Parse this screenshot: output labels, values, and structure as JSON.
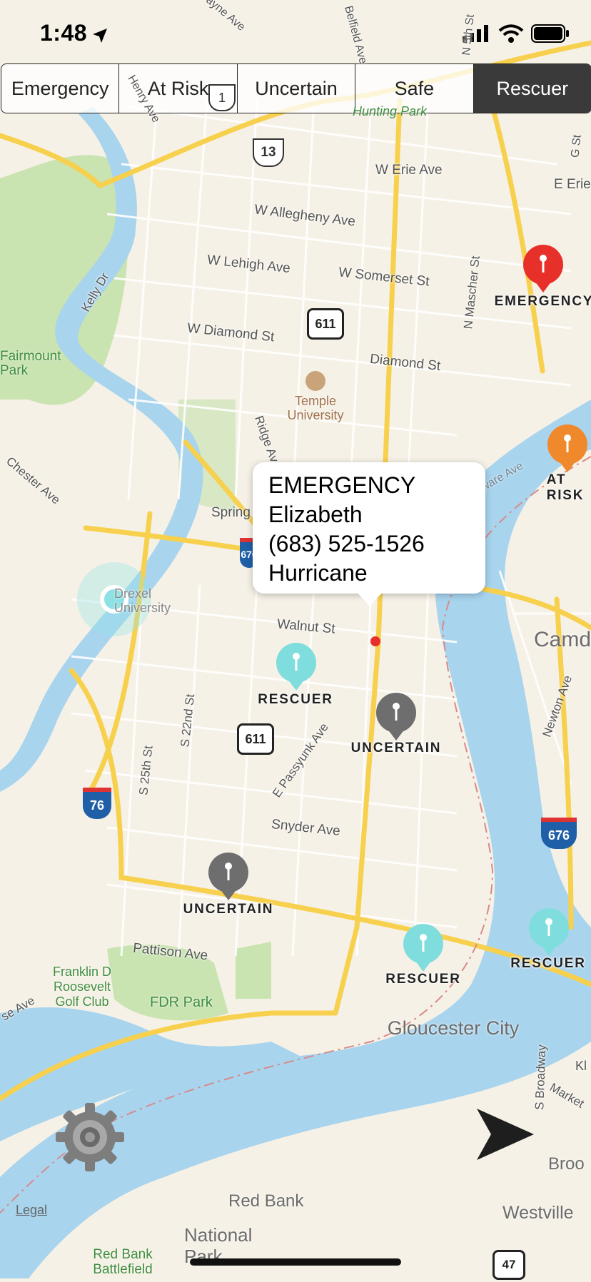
{
  "status_bar": {
    "time": "1:48"
  },
  "filters": {
    "segments": [
      "Emergency",
      "At Risk",
      "Uncertain",
      "Safe",
      "Rescuer"
    ],
    "selected": "Rescuer"
  },
  "pins": [
    {
      "label": "EMERGENCY",
      "color": "#e8302a"
    },
    {
      "label": "AT RISK",
      "color": "#f0892b"
    },
    {
      "label": "RESCUER",
      "color": "#7fdedd"
    },
    {
      "label": "UNCERTAIN",
      "color": "#6e6e6e"
    },
    {
      "label": "UNCERTAIN",
      "color": "#6e6e6e"
    },
    {
      "label": "RESCUER",
      "color": "#7fdedd"
    },
    {
      "label": "RESCUER",
      "color": "#7fdedd"
    }
  ],
  "callout": {
    "status": "EMERGENCY",
    "name": "Elizabeth",
    "phone": "(683) 525-1526",
    "hazard": "Hurricane"
  },
  "map_labels": {
    "w_erie": "W Erie Ave",
    "e_erie": "E Erie",
    "allegheny": "W Allegheny Ave",
    "lehigh": "W Lehigh Ave",
    "somerset": "W Somerset St",
    "diamond_w": "W Diamond St",
    "diamond": "Diamond St",
    "temple": "Temple University",
    "fairmount": "Fairmount Park",
    "kelly": "Kelly Dr",
    "mascher": "N Mascher St",
    "ridge": "Ridge Ave",
    "spring": "Spring",
    "walnut": "Walnut St",
    "drexel": "Drexel University",
    "s25": "S 25th St",
    "s22": "S 22nd St",
    "passyunk": "E Passyunk Ave",
    "snyder": "Snyder Ave",
    "pattison": "Pattison Ave",
    "franklin": "Franklin D Roosevelt Golf Club",
    "fdr": "FDR Park",
    "gloucester": "Gloucester City",
    "camden": "Camd",
    "newton": "Newton Ave",
    "broadway": "S Broadway",
    "market": "Market",
    "brook": "Broo",
    "westville": "Westville",
    "redbank": "Red Bank",
    "national_park": "National Park",
    "redbank_battlefield": "Red Bank Battlefield",
    "legal": "Legal",
    "hunting": "Hunting Park",
    "belfield": "Belfield Ave",
    "n5": "N 5th St",
    "g_st": "G St",
    "henry": "Henry Ave",
    "wayne": "Wayne Ave",
    "chester": "Chester Ave",
    "ave_sw": "se Ave",
    "delaware": "Delaware Ave",
    "kl": "Kl"
  },
  "shields": {
    "us1": "1",
    "us13": "13",
    "pa611_north": "611",
    "pa611_south": "611",
    "i76": "76",
    "i676": "676",
    "i_center": "676",
    "r47": "47"
  },
  "colors": {
    "land": "#f6f1e6",
    "water": "#a8d4ee",
    "park": "#c9e3b1",
    "road_major": "#f7d04e",
    "road_minor": "#ffffff",
    "interstate": "#1f5fa8"
  }
}
